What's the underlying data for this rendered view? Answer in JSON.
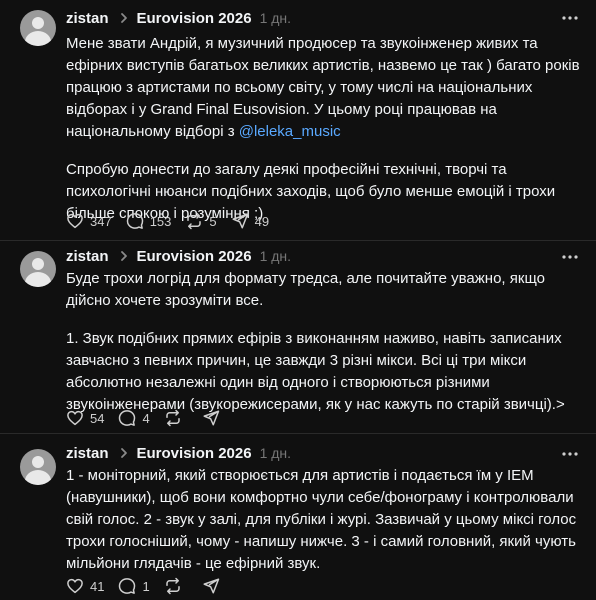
{
  "posts": [
    {
      "username": "zistan",
      "community": "Eurovision 2026",
      "time": "1 дн.",
      "paragraphs": [
        {
          "text": "Мене звати Андрій, я музичний продюсер та звукоінженер живих та ефірних виступів багатьох великих артистів, назвемо це так ) багато років працюю з артистами по всьому світу, у тому числі на національних відборах і у Grand Final Eusovision. У цьому році працював на національному відборі з ",
          "mention": "@leleka_music"
        },
        {
          "text": "Спробую донести до загалу деякі професійні технічні, творчі та психологічні нюанси подібних заходів, щоб було менше емоцій і трохи більше спокою і розуміння ;)"
        }
      ],
      "likes": "347",
      "replies": "153",
      "reposts": "5",
      "shares": "49"
    },
    {
      "username": "zistan",
      "community": "Eurovision 2026",
      "time": "1 дн.",
      "paragraphs": [
        {
          "text": "Буде трохи логрід для формату тредса, але почитайте уважно, якщо дійсно хочете зрозуміти все."
        },
        {
          "text": "1. Звук подібних прямих ефірів з виконанням наживо, навіть записаних завчасно з певних причин, це завжди 3 різні мікси. Всі ці три мікси абсолютно незалежні один від одного і створюються різними звукоінженерами (звукорежисерами, як у нас кажуть по старій звичці).>"
        }
      ],
      "likes": "54",
      "replies": "4",
      "reposts": "",
      "shares": ""
    },
    {
      "username": "zistan",
      "community": "Eurovision 2026",
      "time": "1 дн.",
      "paragraphs": [
        {
          "text": "1 - моніторний, який створюється для артистів і подається їм у IEM (навушники), щоб вони комфортно чули себе/фонограму і контролювали свій голос. 2 - звук у залі, для публіки і журі. Зазвичай у цьому міксі голос трохи голосніший, чому - напишу нижче. 3 - і самий головний, який чують мільйони глядачів - це ефірний звук."
        }
      ],
      "likes": "41",
      "replies": "1",
      "reposts": "",
      "shares": ""
    }
  ]
}
